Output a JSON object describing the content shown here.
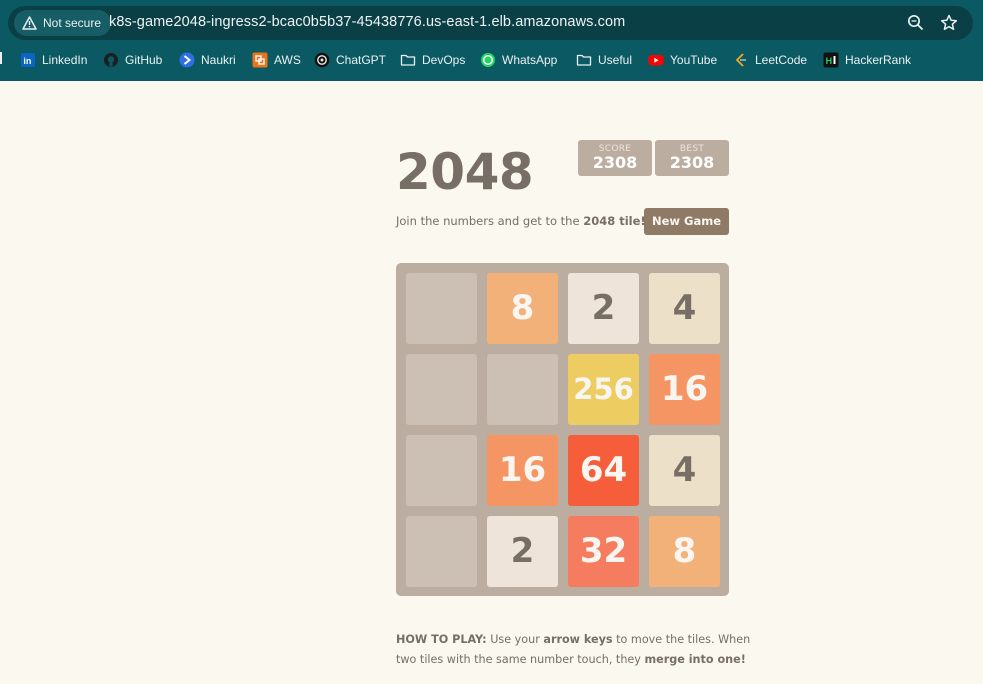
{
  "browser": {
    "security_label": "Not secure",
    "url": "k8s-game2048-ingress2-bcac0b5b37-45438776.us-east-1.elb.amazonaws.com",
    "zoom_icon": "zoom-icon",
    "star_icon": "star-icon",
    "bookmarks": [
      {
        "label": "LinkedIn",
        "icon": "linkedin-icon"
      },
      {
        "label": "GitHub",
        "icon": "github-icon"
      },
      {
        "label": "Naukri",
        "icon": "naukri-icon"
      },
      {
        "label": "AWS",
        "icon": "aws-icon"
      },
      {
        "label": "ChatGPT",
        "icon": "chatgpt-icon"
      },
      {
        "label": "DevOps",
        "icon": "folder-icon"
      },
      {
        "label": "WhatsApp",
        "icon": "whatsapp-icon"
      },
      {
        "label": "Useful",
        "icon": "folder-icon"
      },
      {
        "label": "YouTube",
        "icon": "youtube-icon"
      },
      {
        "label": "LeetCode",
        "icon": "leetcode-icon"
      },
      {
        "label": "HackerRank",
        "icon": "hackerrank-icon"
      }
    ]
  },
  "game": {
    "title": "2048",
    "score_label": "SCORE",
    "score": "2308",
    "best_label": "BEST",
    "best": "2308",
    "intro_prefix": "Join the numbers and get to the ",
    "intro_bold": "2048 tile!",
    "new_game_label": "New Game",
    "grid": [
      [
        null,
        8,
        2,
        4
      ],
      [
        null,
        null,
        256,
        16
      ],
      [
        null,
        16,
        64,
        4
      ],
      [
        null,
        2,
        32,
        8
      ]
    ],
    "howto": {
      "label": "HOW TO PLAY:",
      "text1": " Use your ",
      "bold1": "arrow keys",
      "text2": " to move the tiles. When",
      "text3": "two tiles with the same number touch, they ",
      "bold2": "merge into one!"
    }
  },
  "colors": {
    "chrome": "#0b5a63",
    "background": "#faf8ef",
    "board": "#bbada0",
    "button": "#8f7a66"
  }
}
